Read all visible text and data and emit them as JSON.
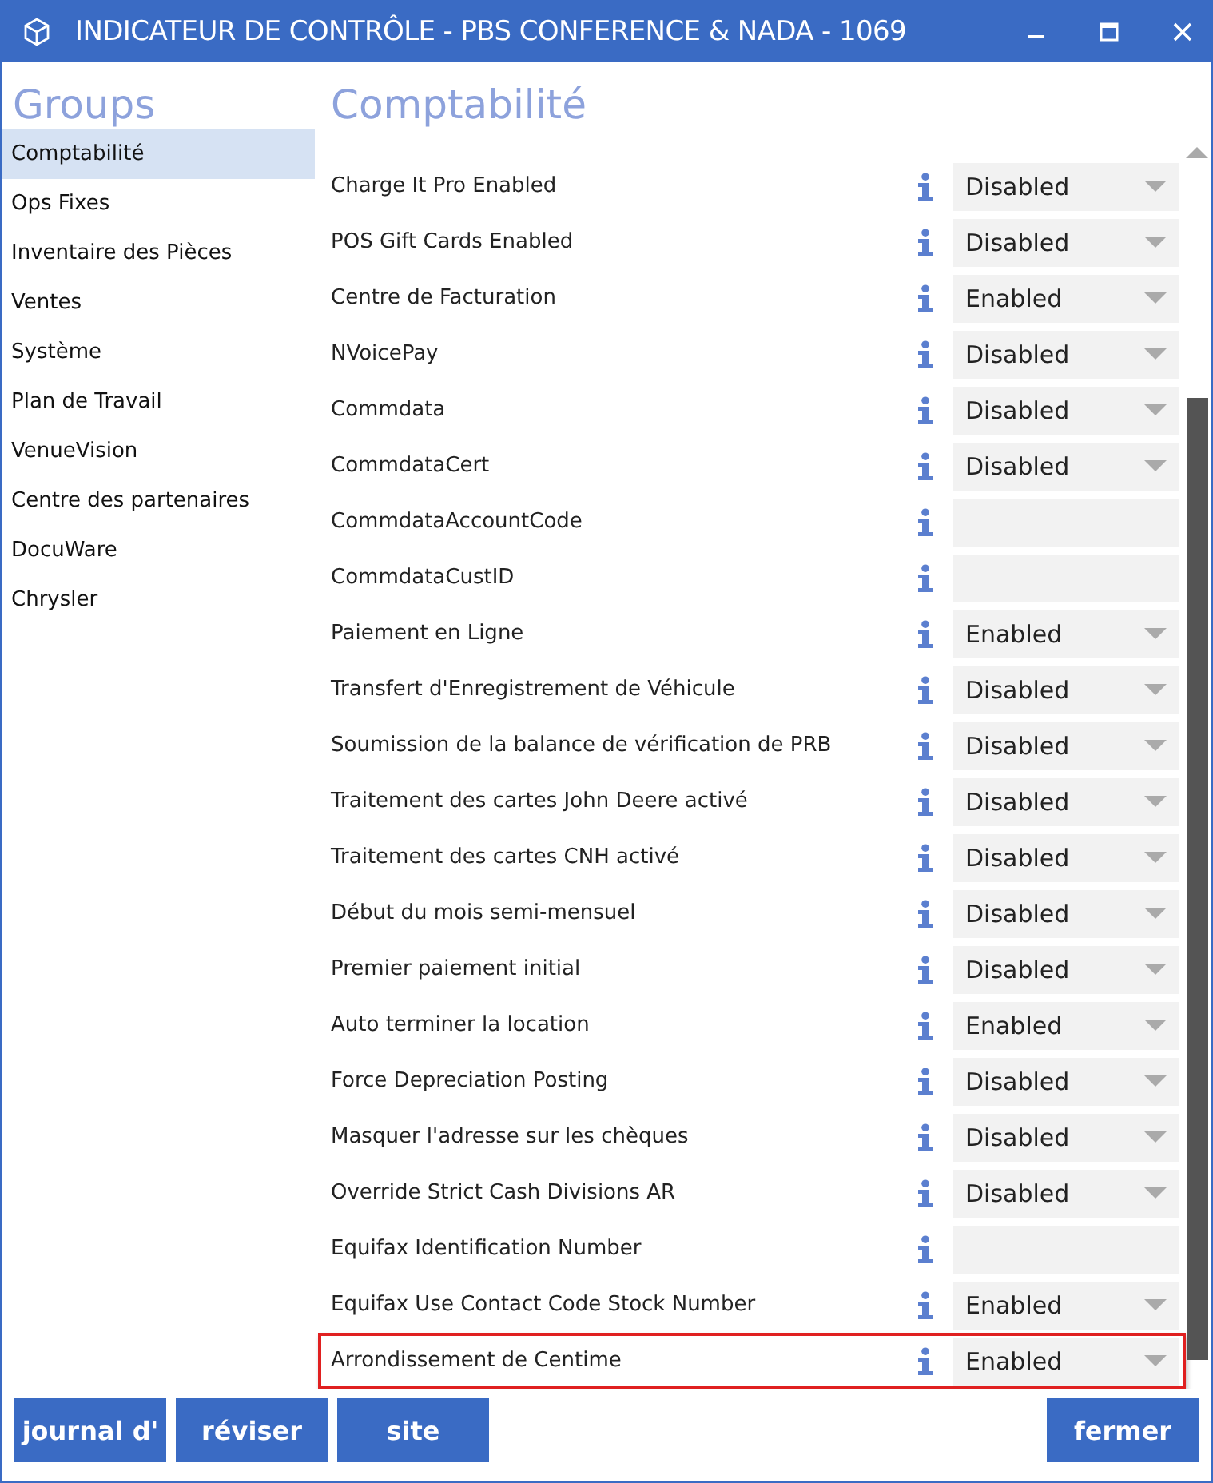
{
  "window": {
    "title": "INDICATEUR DE CONTRÔLE - PBS CONFERENCE & NADA - 1069"
  },
  "sidebar": {
    "title": "Groups",
    "items": [
      {
        "label": "Comptabilité",
        "selected": true
      },
      {
        "label": "Ops Fixes",
        "selected": false
      },
      {
        "label": "Inventaire des Pièces",
        "selected": false
      },
      {
        "label": "Ventes",
        "selected": false
      },
      {
        "label": "Système",
        "selected": false
      },
      {
        "label": "Plan de Travail",
        "selected": false
      },
      {
        "label": "VenueVision",
        "selected": false
      },
      {
        "label": "Centre des partenaires",
        "selected": false
      },
      {
        "label": "DocuWare",
        "selected": false
      },
      {
        "label": "Chrysler",
        "selected": false
      }
    ]
  },
  "section": {
    "title": "Comptabilité",
    "rows": [
      {
        "label": "Charge It Pro Enabled",
        "kind": "dropdown",
        "value": "Disabled",
        "highlighted": false
      },
      {
        "label": "POS Gift Cards Enabled",
        "kind": "dropdown",
        "value": "Disabled",
        "highlighted": false
      },
      {
        "label": "Centre de Facturation",
        "kind": "dropdown",
        "value": "Enabled",
        "highlighted": false
      },
      {
        "label": "NVoicePay",
        "kind": "dropdown",
        "value": "Disabled",
        "highlighted": false
      },
      {
        "label": "Commdata",
        "kind": "dropdown",
        "value": "Disabled",
        "highlighted": false
      },
      {
        "label": "CommdataCert",
        "kind": "dropdown",
        "value": "Disabled",
        "highlighted": false
      },
      {
        "label": "CommdataAccountCode",
        "kind": "text",
        "highlighted": false
      },
      {
        "label": "CommdataCustID",
        "kind": "text",
        "highlighted": false
      },
      {
        "label": "Paiement en Ligne",
        "kind": "dropdown",
        "value": "Enabled",
        "highlighted": false
      },
      {
        "label": "Transfert d'Enregistrement de Véhicule",
        "kind": "dropdown",
        "value": "Disabled",
        "highlighted": false
      },
      {
        "label": "Soumission de la balance de vérification de PRB",
        "kind": "dropdown",
        "value": "Disabled",
        "highlighted": false
      },
      {
        "label": "Traitement des cartes John Deere activé",
        "kind": "dropdown",
        "value": "Disabled",
        "highlighted": false
      },
      {
        "label": "Traitement des cartes CNH activé",
        "kind": "dropdown",
        "value": "Disabled",
        "highlighted": false
      },
      {
        "label": "Début du mois semi-mensuel",
        "kind": "dropdown",
        "value": "Disabled",
        "highlighted": false
      },
      {
        "label": "Premier paiement initial",
        "kind": "dropdown",
        "value": "Disabled",
        "highlighted": false
      },
      {
        "label": "Auto terminer la location",
        "kind": "dropdown",
        "value": "Enabled",
        "highlighted": false
      },
      {
        "label": "Force Depreciation Posting",
        "kind": "dropdown",
        "value": "Disabled",
        "highlighted": false
      },
      {
        "label": "Masquer l'adresse sur les chèques",
        "kind": "dropdown",
        "value": "Disabled",
        "highlighted": false
      },
      {
        "label": "Override Strict Cash Divisions AR",
        "kind": "dropdown",
        "value": "Disabled",
        "highlighted": false
      },
      {
        "label": "Equifax Identification Number",
        "kind": "text",
        "highlighted": false
      },
      {
        "label": "Equifax Use Contact Code Stock Number",
        "kind": "dropdown",
        "value": "Enabled",
        "highlighted": false
      },
      {
        "label": "Arrondissement de Centime",
        "kind": "dropdown",
        "value": "Enabled",
        "highlighted": true
      }
    ]
  },
  "buttons": {
    "left": [
      "journal d'",
      "réviser",
      "site"
    ],
    "right": [
      "fermer"
    ]
  }
}
